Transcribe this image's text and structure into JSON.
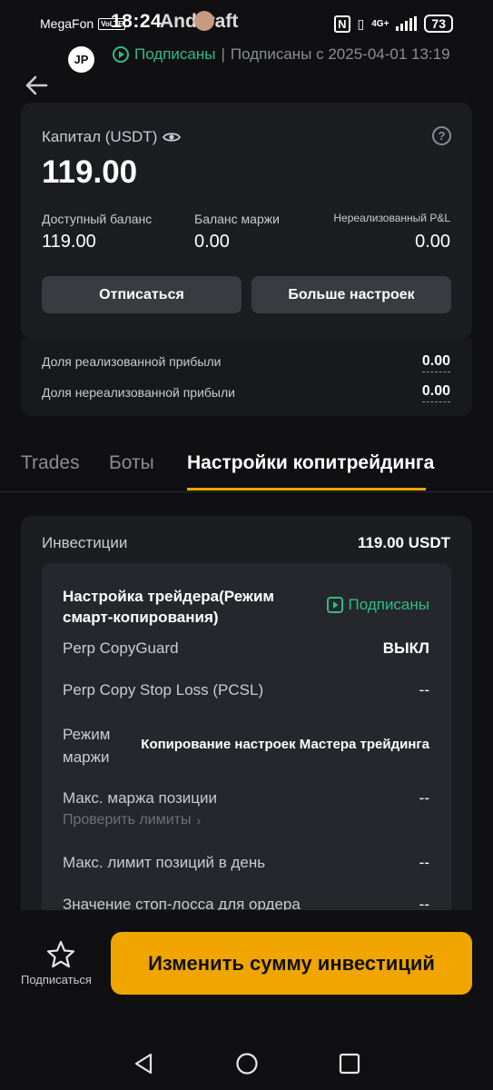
{
  "status_bar": {
    "carrier": "MegaFon",
    "volte": "VoLTE",
    "time": "18:24",
    "app_label": "Andcraft",
    "network": "4G+",
    "battery": "73"
  },
  "header": {
    "avatar_initials": "JP",
    "subscribed_label": "Подписаны",
    "subscribed_since": "Подписаны с 2025-04-01 13:19"
  },
  "capital": {
    "label": "Капитал (USDT)",
    "value": "119.00",
    "available_label": "Доступный баланс",
    "available_value": "119.00",
    "margin_label": "Баланс маржи",
    "margin_value": "0.00",
    "pnl_label": "Нереализованный P&L",
    "pnl_value": "0.00",
    "unsubscribe_button": "Отписаться",
    "more_settings_button": "Больше настроек",
    "realized_share_label": "Доля реализованной прибыли",
    "realized_share_value": "0.00",
    "unrealized_share_label": "Доля нереализованной прибыли",
    "unrealized_share_value": "0.00"
  },
  "tabs": [
    {
      "label": "Trades"
    },
    {
      "label": "Боты"
    },
    {
      "label": "Настройки копитрейдинга"
    }
  ],
  "settings": {
    "investments_label": "Инвестиции",
    "investments_value": "119.00 USDT",
    "trader_setting_title": "Настройка трейдера(Режим смарт-копирования)",
    "trader_setting_status": "Подписаны",
    "rows": [
      {
        "label": "Perp CopyGuard",
        "value": "ВЫКЛ"
      },
      {
        "label": "Perp Copy Stop Loss (PCSL)",
        "value": "--"
      },
      {
        "label": "Режим маржи",
        "value": "Копирование настроек Мастера трейдинга"
      },
      {
        "label": "Макс. маржа позиции",
        "value": "--",
        "link": "Проверить лимиты"
      },
      {
        "label": "Макс. лимит позиций в день",
        "value": "--"
      },
      {
        "label": "Значение стоп-лосса для ордера",
        "value": "--"
      }
    ]
  },
  "bottom": {
    "subscribe_label": "Подписаться",
    "cta_label": "Изменить сумму инвестиций"
  },
  "colors": {
    "accent": "#f0a500",
    "positive": "#2ebd85",
    "background": "#101012",
    "card": "#1c1d21"
  }
}
